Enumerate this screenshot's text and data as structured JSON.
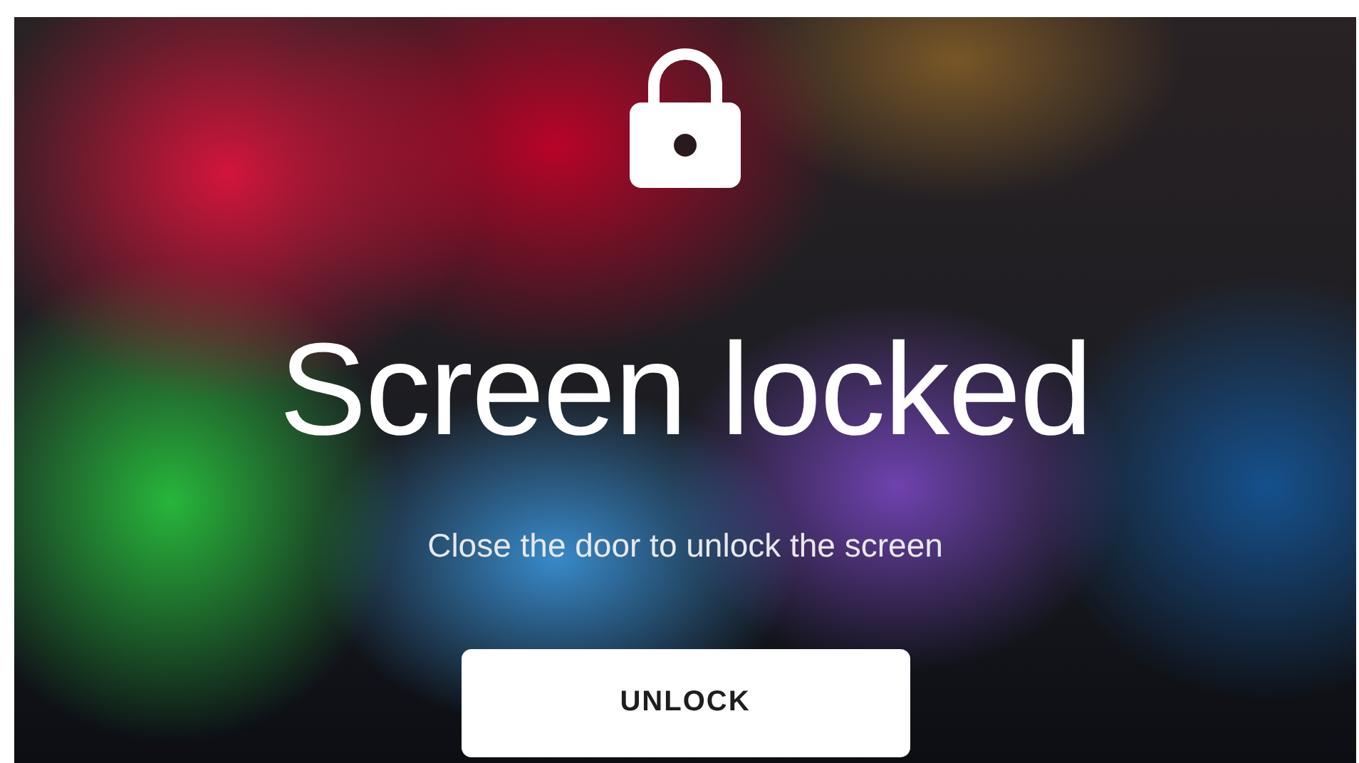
{
  "lock_screen": {
    "title": "Screen locked",
    "message": "Close the door to unlock the screen",
    "unlock_button": {
      "label": "UNLOCK"
    }
  }
}
